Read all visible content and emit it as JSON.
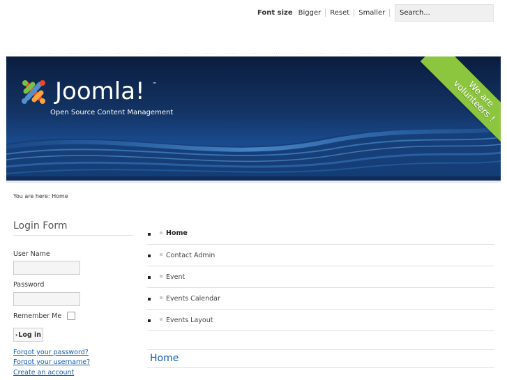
{
  "header": {
    "font_size_label": "Font size",
    "font_links": [
      "Bigger",
      "Reset",
      "Smaller"
    ],
    "search_placeholder": "Search..."
  },
  "banner": {
    "logo_text": "Joomla!",
    "logo_tm": "™",
    "tagline": "Open Source Content Management",
    "ribbon_line1": "We are",
    "ribbon_line2": "volunteers !",
    "ribbon_color": "#8cc63f"
  },
  "breadcrumb": {
    "text": "You are here: Home"
  },
  "login": {
    "title": "Login Form",
    "username_label": "User Name",
    "password_label": "Password",
    "remember_label": "Remember Me",
    "login_button": "Log in",
    "forgot_password": "Forgot your password?",
    "forgot_username": "Forgot your username?",
    "create_account": "Create an account"
  },
  "menu": {
    "items": [
      {
        "label": "Home",
        "active": true
      },
      {
        "label": "Contact Admin",
        "active": false
      },
      {
        "label": "Event",
        "active": false
      },
      {
        "label": "Events Calendar",
        "active": false
      },
      {
        "label": "Events Layout",
        "active": false
      }
    ]
  },
  "content": {
    "title": "Home"
  },
  "colors": {
    "link": "#135cae",
    "banner_dark": "#0b1d3f",
    "banner_light": "#1a4b8f"
  }
}
